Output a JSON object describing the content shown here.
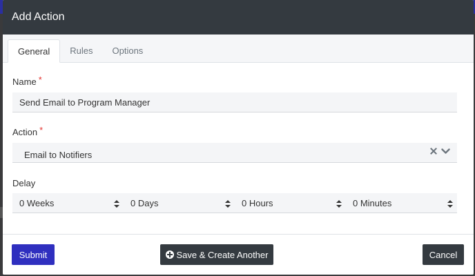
{
  "modal": {
    "title": "Add Action"
  },
  "tabs": [
    {
      "label": "General",
      "active": true
    },
    {
      "label": "Rules",
      "active": false
    },
    {
      "label": "Options",
      "active": false
    }
  ],
  "form": {
    "name": {
      "label": "Name",
      "required_mark": "*",
      "value": "Send Email to Program Manager"
    },
    "action": {
      "label": "Action",
      "required_mark": "*",
      "value": "Email to Notifiers",
      "clear_icon": "close-icon",
      "dropdown_icon": "chevron-down-icon"
    },
    "delay": {
      "label": "Delay",
      "weeks": "0 Weeks",
      "days": "0 Days",
      "hours": "0 Hours",
      "minutes": "0 Minutes"
    }
  },
  "footer": {
    "submit_label": "Submit",
    "save_create_label": "Save & Create Another",
    "save_create_icon": "plus-circle-icon",
    "cancel_label": "Cancel"
  },
  "colors": {
    "header_bg": "#343a40",
    "primary": "#2f2fbf",
    "dark_button": "#343a40",
    "required": "#e3342f"
  }
}
